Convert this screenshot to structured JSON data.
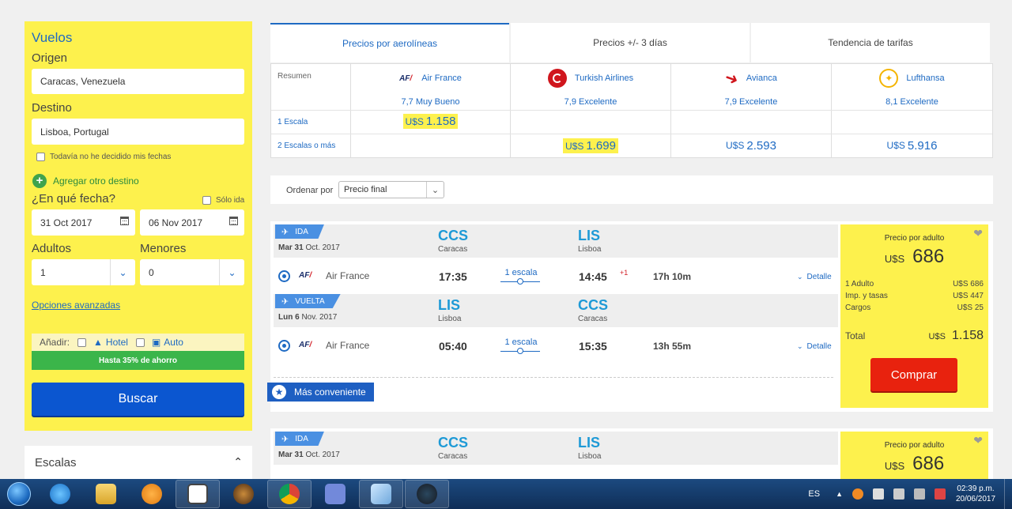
{
  "search": {
    "title": "Vuelos",
    "origin_label": "Origen",
    "origin_value": "Caracas, Venezuela",
    "dest_label": "Destino",
    "dest_value": "Lisboa, Portugal",
    "undecided_label": "Todavía no he decidido mis fechas",
    "add_dest_label": "Agregar otro destino",
    "date_question": "¿En qué fecha?",
    "solo_ida_label": "Sólo ida",
    "date_from": "31 Oct 2017",
    "date_to": "06 Nov 2017",
    "adults_label": "Adultos",
    "adults_value": "1",
    "minors_label": "Menores",
    "minors_value": "0",
    "advanced_label": "Opciones avanzadas",
    "add_label": "Añadir:",
    "hotel_label": "Hotel",
    "auto_label": "Auto",
    "savings_text": "Hasta 35% de ahorro",
    "search_button": "Buscar"
  },
  "filters": {
    "stops_label": "Escalas"
  },
  "tabs": [
    {
      "label": "Precios por aerolíneas",
      "active": true
    },
    {
      "label": "Precios +/- 3 días",
      "active": false
    },
    {
      "label": "Tendencia de tarifas",
      "active": false
    }
  ],
  "matrix": {
    "summary_label": "Resumen",
    "row1_label": "1 Escala",
    "row2_label": "2 Escalas o más",
    "airlines": [
      {
        "name": "Air France",
        "rating": "7,7 Muy Bueno",
        "one_stop_currency": "U$S",
        "one_stop_price": "1.158",
        "two_stop_currency": "",
        "two_stop_price": "",
        "icon": "air-france-logo"
      },
      {
        "name": "Turkish Airlines",
        "rating": "7,9 Excelente",
        "one_stop_currency": "",
        "one_stop_price": "",
        "two_stop_currency": "U$S",
        "two_stop_price": "1.699",
        "icon": "turkish-airlines-logo"
      },
      {
        "name": "Avianca",
        "rating": "7,9 Excelente",
        "one_stop_currency": "",
        "one_stop_price": "",
        "two_stop_currency": "U$S",
        "two_stop_price": "2.593",
        "icon": "avianca-logo"
      },
      {
        "name": "Lufthansa",
        "rating": "8,1 Excelente",
        "one_stop_currency": "",
        "one_stop_price": "",
        "two_stop_currency": "U$S",
        "two_stop_price": "5.916",
        "icon": "lufthansa-logo"
      }
    ]
  },
  "order": {
    "label": "Ordenar por",
    "value": "Precio final"
  },
  "results": [
    {
      "outbound": {
        "badge": "IDA",
        "day": "Mar 31",
        "month_year": "Oct. 2017",
        "from_code": "CCS",
        "from_city": "Caracas",
        "to_code": "LIS",
        "to_city": "Lisboa",
        "airline": "Air France",
        "logo_text": "AF",
        "depart": "17:35",
        "stops": "1 escala",
        "arrive": "14:45",
        "plus_day": "+1",
        "duration": "17h 10m",
        "detail": "Detalle"
      },
      "inbound": {
        "badge": "VUELTA",
        "day": "Lun 6",
        "month_year": "Nov. 2017",
        "from_code": "LIS",
        "from_city": "Lisboa",
        "to_code": "CCS",
        "to_city": "Caracas",
        "airline": "Air France",
        "logo_text": "AF",
        "depart": "05:40",
        "stops": "1 escala",
        "arrive": "15:35",
        "duration": "13h 55m",
        "detail": "Detalle"
      },
      "tag": "Más conveniente",
      "price": {
        "label": "Precio por adulto",
        "currency": "U$S",
        "amount": "686",
        "rows": [
          {
            "label": "1 Adulto",
            "value": "U$S 686"
          },
          {
            "label": "Imp. y tasas",
            "value": "U$S 447"
          },
          {
            "label": "Cargos",
            "value": "U$S 25"
          }
        ],
        "total_label": "Total",
        "total_currency": "U$S",
        "total_amount": "1.158",
        "buy_label": "Comprar"
      }
    },
    {
      "outbound": {
        "badge": "IDA",
        "day": "Mar 31",
        "month_year": "Oct. 2017",
        "from_code": "CCS",
        "from_city": "Caracas",
        "to_code": "LIS",
        "to_city": "Lisboa"
      },
      "price": {
        "label": "Precio por adulto",
        "currency": "U$S",
        "amount": "686"
      }
    }
  ],
  "taskbar": {
    "apps": [
      "windows-explorer-icon",
      "internet-explorer-icon",
      "file-explorer-icon",
      "media-player-icon",
      "document-icon",
      "game-icon",
      "chrome-icon",
      "discord-icon",
      "notepad-icon",
      "steam-icon"
    ],
    "language": "ES",
    "time": "02:39 p.m.",
    "date": "20/06/2017"
  }
}
